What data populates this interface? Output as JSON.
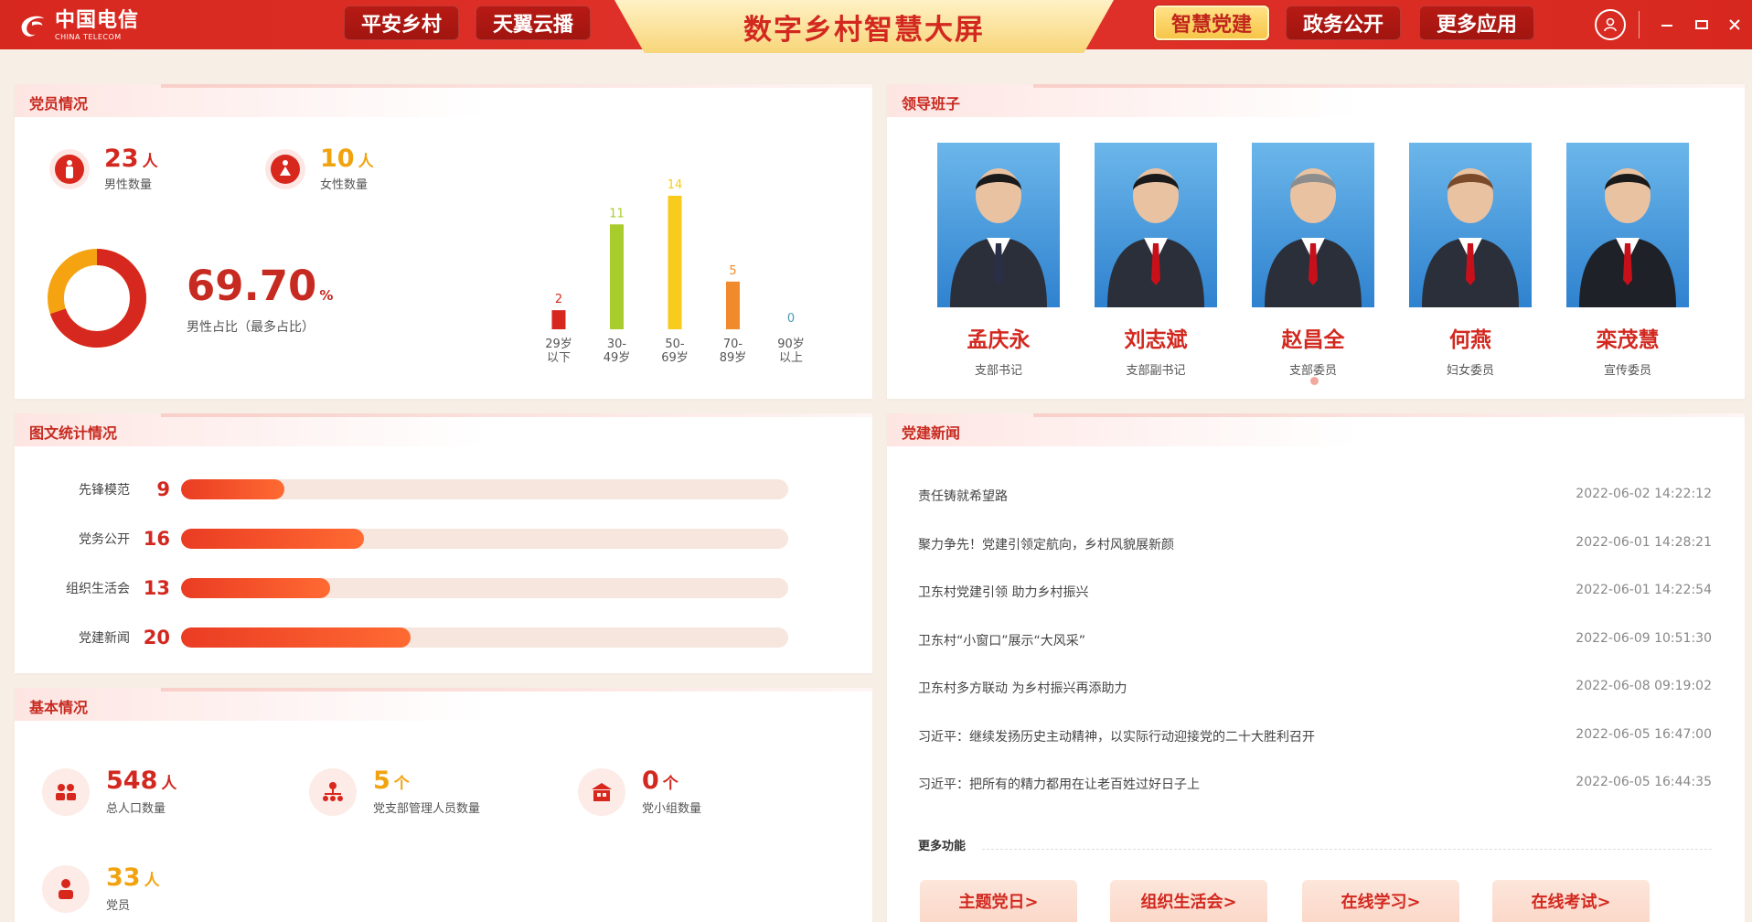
{
  "header": {
    "logo_cn": "中国电信",
    "logo_en": "CHINA TELECOM",
    "title": "数字乡村智慧大屏",
    "nav_left": [
      "平安乡村",
      "天翼云播"
    ],
    "nav_right": [
      "智慧党建",
      "政务公开",
      "更多应用"
    ],
    "active_nav": "智慧党建",
    "window_controls": [
      "user-icon",
      "minimize-icon",
      "maximize-icon",
      "close-icon"
    ]
  },
  "members": {
    "title": "党员情况",
    "male": {
      "value": "23",
      "unit": "人",
      "label": "男性数量"
    },
    "female": {
      "value": "10",
      "unit": "人",
      "label": "女性数量"
    },
    "ratio": {
      "value": "69.70",
      "unit": "%",
      "label": "男性占比（最多占比）",
      "fraction": 0.697
    },
    "colors": {
      "male": "#d7281f",
      "female": "#f6a312"
    }
  },
  "chart_data": {
    "type": "bar",
    "categories": [
      "29岁以下",
      "30-49岁",
      "50-69岁",
      "70-89岁",
      "90岁以上"
    ],
    "category_lines": [
      [
        "29岁",
        "以下"
      ],
      [
        "30-",
        "49岁"
      ],
      [
        "50-",
        "69岁"
      ],
      [
        "70-",
        "89岁"
      ],
      [
        "90岁",
        "以上"
      ]
    ],
    "values": [
      2,
      11,
      14,
      5,
      0
    ],
    "colors": [
      "#d7281f",
      "#a9cc2d",
      "#f8cb1c",
      "#f08a2a",
      "#4a9bb0"
    ],
    "title": "",
    "xlabel": "",
    "ylabel": "",
    "ylim": [
      0,
      14
    ]
  },
  "leaders": {
    "title": "领导班子",
    "people": [
      {
        "name": "孟庆永",
        "role": "支部书记"
      },
      {
        "name": "刘志斌",
        "role": "支部副书记"
      },
      {
        "name": "赵昌全",
        "role": "支部委员"
      },
      {
        "name": "何燕",
        "role": "妇女委员"
      },
      {
        "name": "栾茂慧",
        "role": "宣传委员"
      }
    ]
  },
  "stats": {
    "title": "图文统计情况",
    "max": 53,
    "rows": [
      {
        "label": "先锋模范",
        "value": 9
      },
      {
        "label": "党务公开",
        "value": 16
      },
      {
        "label": "组织生活会",
        "value": 13
      },
      {
        "label": "党建新闻",
        "value": 20
      }
    ]
  },
  "basic": {
    "title": "基本情况",
    "items": [
      {
        "value": "548",
        "unit": "人",
        "label": "总人口数量",
        "icon": "people-icon"
      },
      {
        "value": "5",
        "unit": "个",
        "label": "党支部管理人员数量",
        "icon": "org-chart-icon"
      },
      {
        "value": "0",
        "unit": "个",
        "label": "党小组数量",
        "icon": "building-icon"
      },
      {
        "value": "33",
        "unit": "人",
        "label": "党员",
        "icon": "person-icon"
      }
    ]
  },
  "news": {
    "title": "党建新闻",
    "items": [
      {
        "title": "责任铸就希望路",
        "date": "2022-06-02 14:22:12"
      },
      {
        "title": "聚力争先！党建引领定航向，乡村风貌展新颜",
        "date": "2022-06-01 14:28:21"
      },
      {
        "title": "卫东村党建引领 助力乡村振兴",
        "date": "2022-06-01 14:22:54"
      },
      {
        "title": "卫东村“小窗口”展示“大风采”",
        "date": "2022-06-09 10:51:30"
      },
      {
        "title": "卫东村多方联动 为乡村振兴再添助力",
        "date": "2022-06-08 09:19:02"
      },
      {
        "title": "习近平：继续发扬历史主动精神，以实际行动迎接党的二十大胜利召开",
        "date": "2022-06-05 16:47:00"
      },
      {
        "title": "习近平：把所有的精力都用在让老百姓过好日子上",
        "date": "2022-06-05 16:44:35"
      }
    ],
    "more_title": "更多功能",
    "buttons": [
      "主题党日>",
      "组织生活会>",
      "在线学习>",
      "在线考试>"
    ]
  }
}
